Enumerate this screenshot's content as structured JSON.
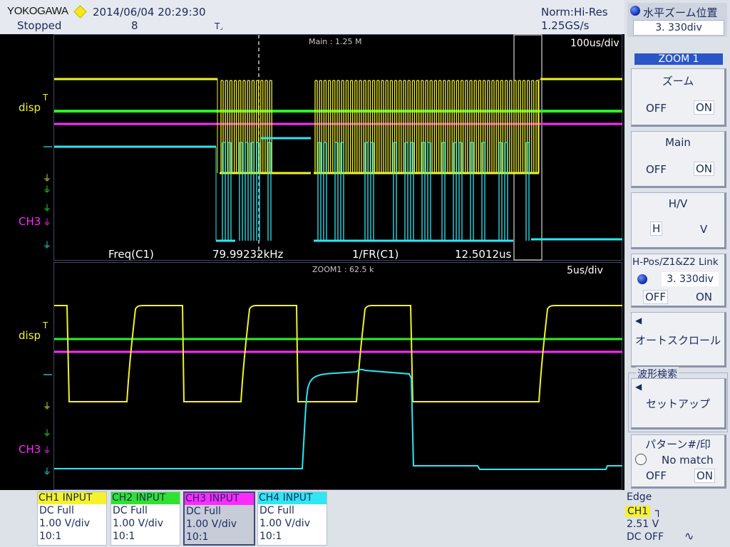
{
  "status": {
    "brand": "YOKOGAWA",
    "datetime": "2014/06/04 20:29:30",
    "state": "Stopped",
    "count": "8",
    "acq_mode": "Norm:Hi-Res",
    "sample_rate": "1.25GS/s"
  },
  "main_window": {
    "label": "Main : 1.25 M",
    "time_div": "100us/div",
    "meas1_name": "Freq(C1)",
    "meas1_value": "79.99232kHz",
    "meas2_name": "1/FR(C1)",
    "meas2_value": "12.5012us"
  },
  "zoom_window": {
    "label": "ZOOM1 : 62.5 k",
    "time_div": "5us/div"
  },
  "markers": {
    "disp": "disp",
    "ch3": "CH3",
    "trig": "T"
  },
  "panel": {
    "header_title": "水平ズーム位置",
    "header_value": "3. 330div",
    "zoom_tab": "ZOOM 1",
    "zoom": {
      "title": "ズーム",
      "off": "OFF",
      "on": "ON"
    },
    "main": {
      "title": "Main",
      "off": "OFF",
      "on": "ON"
    },
    "hv": {
      "title": "H/V",
      "h": "H",
      "v": "V"
    },
    "link": {
      "title": "H-Pos/Z1&Z2 Link",
      "value": "3. 330div",
      "off": "OFF",
      "on": "ON"
    },
    "autoscroll": "オートスクロール",
    "search_group": "波形検索",
    "setup": "セットアップ",
    "pattern": {
      "title": "パターン#/印",
      "status": "No match",
      "off": "OFF",
      "on": "ON"
    }
  },
  "channels": [
    {
      "name": "CH1 INPUT",
      "coupling": "DC Full",
      "scale": "1.00 V/div",
      "probe": "10:1",
      "color": "#f4f42a"
    },
    {
      "name": "CH2 INPUT",
      "coupling": "DC Full",
      "scale": "1.00 V/div",
      "probe": "10:1",
      "color": "#2ee82e"
    },
    {
      "name": "CH3 INPUT",
      "coupling": "DC Full",
      "scale": "1.00 V/div",
      "probe": "10:1",
      "color": "#ff1dff"
    },
    {
      "name": "CH4 INPUT",
      "coupling": "DC Full",
      "scale": "1.00 V/div",
      "probe": "10:1",
      "color": "#2fe6f4"
    }
  ],
  "trigger": {
    "type": "Edge",
    "source": "CH1",
    "level": "2.51 V",
    "coupling": "DC OFF"
  },
  "colors": {
    "ch1": "#f2f226",
    "ch2": "#2af02a",
    "ch3": "#ff2aff",
    "ch4": "#2ae8f5",
    "grid": "#3d4a66"
  }
}
